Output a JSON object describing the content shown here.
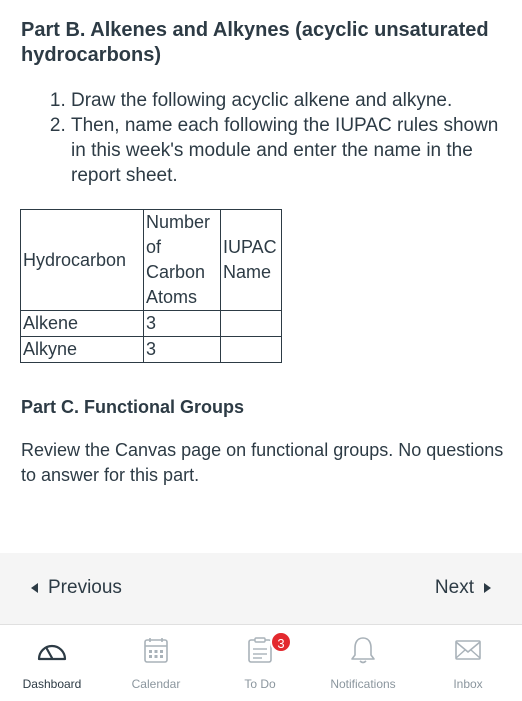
{
  "content": {
    "part_b_title": "Part B. Alkenes and Alkynes (acyclic unsaturated hydrocarbons)",
    "steps": [
      "Draw the following acyclic alkene and alkyne.",
      "Then, name each following the IUPAC rules shown in this week's module and enter the name in the report sheet."
    ],
    "table": {
      "headers": [
        "Hydrocarbon",
        "Number of Carbon Atoms",
        "IUPAC Name"
      ],
      "rows": [
        [
          "Alkene",
          "3",
          ""
        ],
        [
          "Alkyne",
          "3",
          ""
        ]
      ]
    },
    "part_c_title": "Part C. Functional Groups",
    "part_c_text": "Review the Canvas page on functional groups. No questions to answer for this part."
  },
  "pager": {
    "previous_label": "Previous",
    "next_label": "Next"
  },
  "tabbar": {
    "tabs": [
      {
        "label": "Dashboard",
        "icon": "dashboard-icon",
        "active": true
      },
      {
        "label": "Calendar",
        "icon": "calendar-icon"
      },
      {
        "label": "To Do",
        "icon": "todo-icon",
        "badge": "3"
      },
      {
        "label": "Notifications",
        "icon": "bell-icon"
      },
      {
        "label": "Inbox",
        "icon": "envelope-icon"
      }
    ]
  },
  "colors": {
    "text": "#2d3b45",
    "muted": "#8b969e",
    "pager_bg": "#f5f5f5",
    "badge": "#e3292e"
  }
}
